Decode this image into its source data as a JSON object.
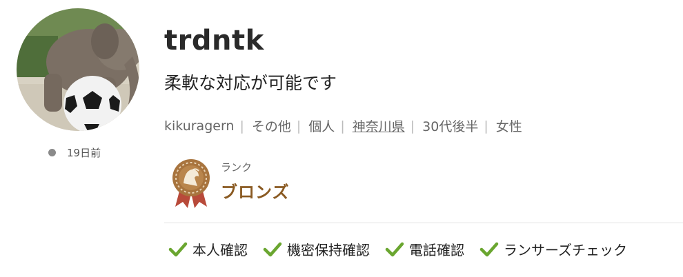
{
  "profile": {
    "avatar_alt": "elephant-with-soccer-ball",
    "last_active": "19日前",
    "username": "trdntk",
    "catchphrase": "柔軟な対応が可能です",
    "meta": {
      "login_id": "kikuragern",
      "occupation": "その他",
      "type": "個人",
      "prefecture": "神奈川県",
      "age": "30代後半",
      "gender": "女性"
    },
    "rank": {
      "label": "ランク",
      "value": "ブロンズ",
      "color": "#8a5a22"
    },
    "verifications": [
      {
        "label": "本人確認",
        "icon": "check-icon"
      },
      {
        "label": "機密保持確認",
        "icon": "check-icon"
      },
      {
        "label": "電話確認",
        "icon": "check-icon"
      },
      {
        "label": "ランサーズチェック",
        "icon": "check-icon"
      }
    ],
    "colors": {
      "check": "#6aa630",
      "status_dot": "#8a8a8a"
    }
  }
}
